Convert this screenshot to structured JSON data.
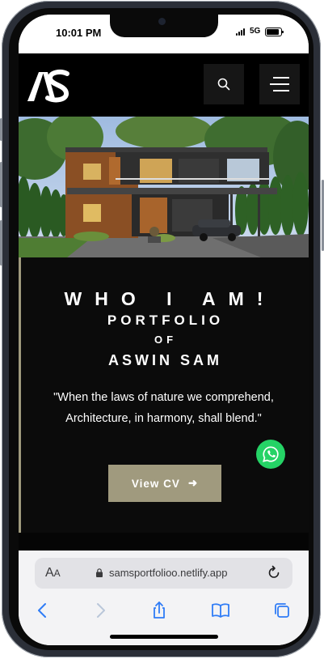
{
  "status_bar": {
    "time": "10:01 PM",
    "network": "5G"
  },
  "site": {
    "logo_text": "AS",
    "search_icon": "search-icon",
    "menu_icon": "hamburger-menu-icon"
  },
  "hero": {
    "heading_who": "WHO I AM!",
    "heading_portfolio": "PORTFOLIO",
    "heading_of": "OF",
    "heading_name": "ASWIN SAM",
    "quote": "\"When the laws of nature we comprehend, Architecture, in harmony, shall blend.\"",
    "cv_button": "View CV",
    "cv_arrow": "➜"
  },
  "floating": {
    "whatsapp_icon": "whatsapp-icon"
  },
  "safari": {
    "aa_label_big": "A",
    "aa_label_small": "A",
    "url": "samsportfolioo.netlify.app"
  },
  "colors": {
    "accent": "#a09a7e",
    "whatsapp": "#25d366",
    "safari_blue": "#2f7cf6"
  }
}
